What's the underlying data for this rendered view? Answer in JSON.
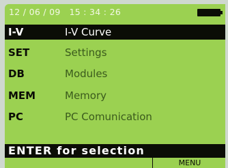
{
  "status": {
    "datetime": "12 / 06 / 09   15 : 34 : 26",
    "battery_icon": "battery-icon"
  },
  "menu": {
    "selected_index": 0,
    "items": [
      {
        "key": "I-V",
        "label": "I-V Curve"
      },
      {
        "key": "SET",
        "label": "Settings"
      },
      {
        "key": "DB",
        "label": "Modules"
      },
      {
        "key": "MEM",
        "label": "Memory"
      },
      {
        "key": "PC",
        "label": "PC Comunication"
      }
    ]
  },
  "footer": {
    "prompt": "ENTER for selection"
  },
  "softkeys": {
    "right": "MENU"
  },
  "colors": {
    "screen_background": "#9bd151",
    "highlight": "#0b0d06",
    "highlight_text": "#ffffff",
    "label_text": "#3a5a1c"
  }
}
